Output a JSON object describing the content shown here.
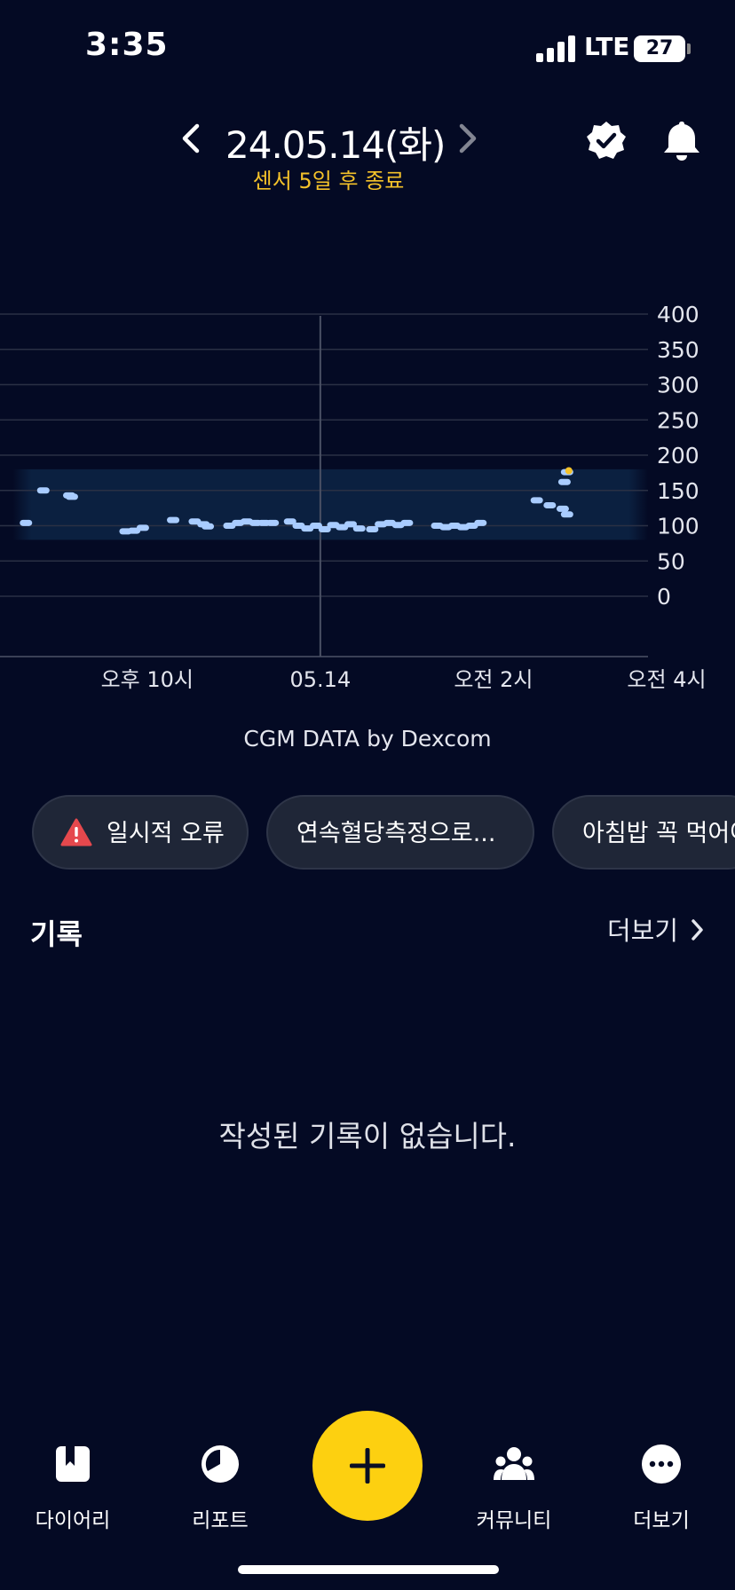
{
  "status_bar": {
    "time": "3:35",
    "network": "LTE",
    "battery": "27"
  },
  "header": {
    "date": "24.05.14(화)",
    "sensor_status": "센서 5일 후 종료"
  },
  "colors": {
    "background": "#040a24",
    "accent": "#fdd010",
    "sensor_text": "#f4c22a",
    "glucose_line": "#a9ccff",
    "target_band": "#0b2040",
    "error": "#e5484d"
  },
  "chart_data": {
    "type": "scatter",
    "title": "",
    "xlabel": "",
    "ylabel": "",
    "y_ticks": [
      400,
      350,
      300,
      250,
      200,
      150,
      100,
      50,
      0
    ],
    "ylim": [
      0,
      400
    ],
    "x_tick_labels": [
      "오후 10시",
      "05.14",
      "오전 2시",
      "오전 4시"
    ],
    "x_ticks_hours": [
      -2,
      0,
      2,
      4
    ],
    "xlim_hours": [
      -3.7,
      4.4
    ],
    "cursor_hour": 0,
    "target_range": [
      80,
      180
    ],
    "grid": true,
    "series": [
      {
        "points": [
          [
            -3.4,
            104
          ],
          [
            -3.2,
            150
          ],
          [
            -2.9,
            143
          ],
          [
            -2.87,
            141
          ],
          [
            -2.25,
            92
          ],
          [
            -2.15,
            93
          ],
          [
            -2.05,
            97
          ],
          [
            -1.7,
            108
          ],
          [
            -1.45,
            106
          ],
          [
            -1.35,
            102
          ],
          [
            -1.3,
            99
          ],
          [
            -1.05,
            100
          ],
          [
            -0.95,
            104
          ],
          [
            -0.85,
            106
          ],
          [
            -0.75,
            104
          ],
          [
            -0.65,
            104
          ],
          [
            -0.55,
            104
          ],
          [
            -0.35,
            106
          ],
          [
            -0.25,
            100
          ],
          [
            -0.15,
            96
          ],
          [
            -0.05,
            100
          ],
          [
            0.05,
            95
          ],
          [
            0.15,
            101
          ],
          [
            0.25,
            98
          ],
          [
            0.35,
            102
          ],
          [
            0.45,
            96
          ],
          [
            0.6,
            95
          ],
          [
            0.7,
            102
          ],
          [
            0.8,
            104
          ],
          [
            0.9,
            101
          ],
          [
            1.0,
            104
          ],
          [
            1.35,
            100
          ],
          [
            1.45,
            98
          ],
          [
            1.55,
            100
          ],
          [
            1.65,
            98
          ],
          [
            1.75,
            100
          ],
          [
            1.85,
            104
          ],
          [
            2.5,
            136
          ],
          [
            2.65,
            129
          ],
          [
            2.8,
            124
          ],
          [
            2.85,
            116
          ],
          [
            2.82,
            162
          ],
          [
            2.85,
            176
          ]
        ]
      }
    ],
    "latest_point": [
      2.87,
      178
    ],
    "credit": "CGM DATA by Dexcom"
  },
  "chips": [
    {
      "label": "일시적 오류",
      "icon": "warning-icon"
    },
    {
      "label": "연속혈당측정으로..."
    },
    {
      "label": "아침밥 꼭 먹어야"
    }
  ],
  "records": {
    "title": "기록",
    "more": "더보기",
    "empty": "작성된 기록이 없습니다."
  },
  "tabs": {
    "diary": {
      "label": "다이어리",
      "icon": "diary-icon"
    },
    "report": {
      "label": "리포트",
      "icon": "report-pie-icon"
    },
    "add": {
      "icon": "plus-icon"
    },
    "community": {
      "label": "커뮤니티",
      "icon": "community-icon"
    },
    "more": {
      "label": "더보기",
      "icon": "more-dots-icon"
    }
  }
}
